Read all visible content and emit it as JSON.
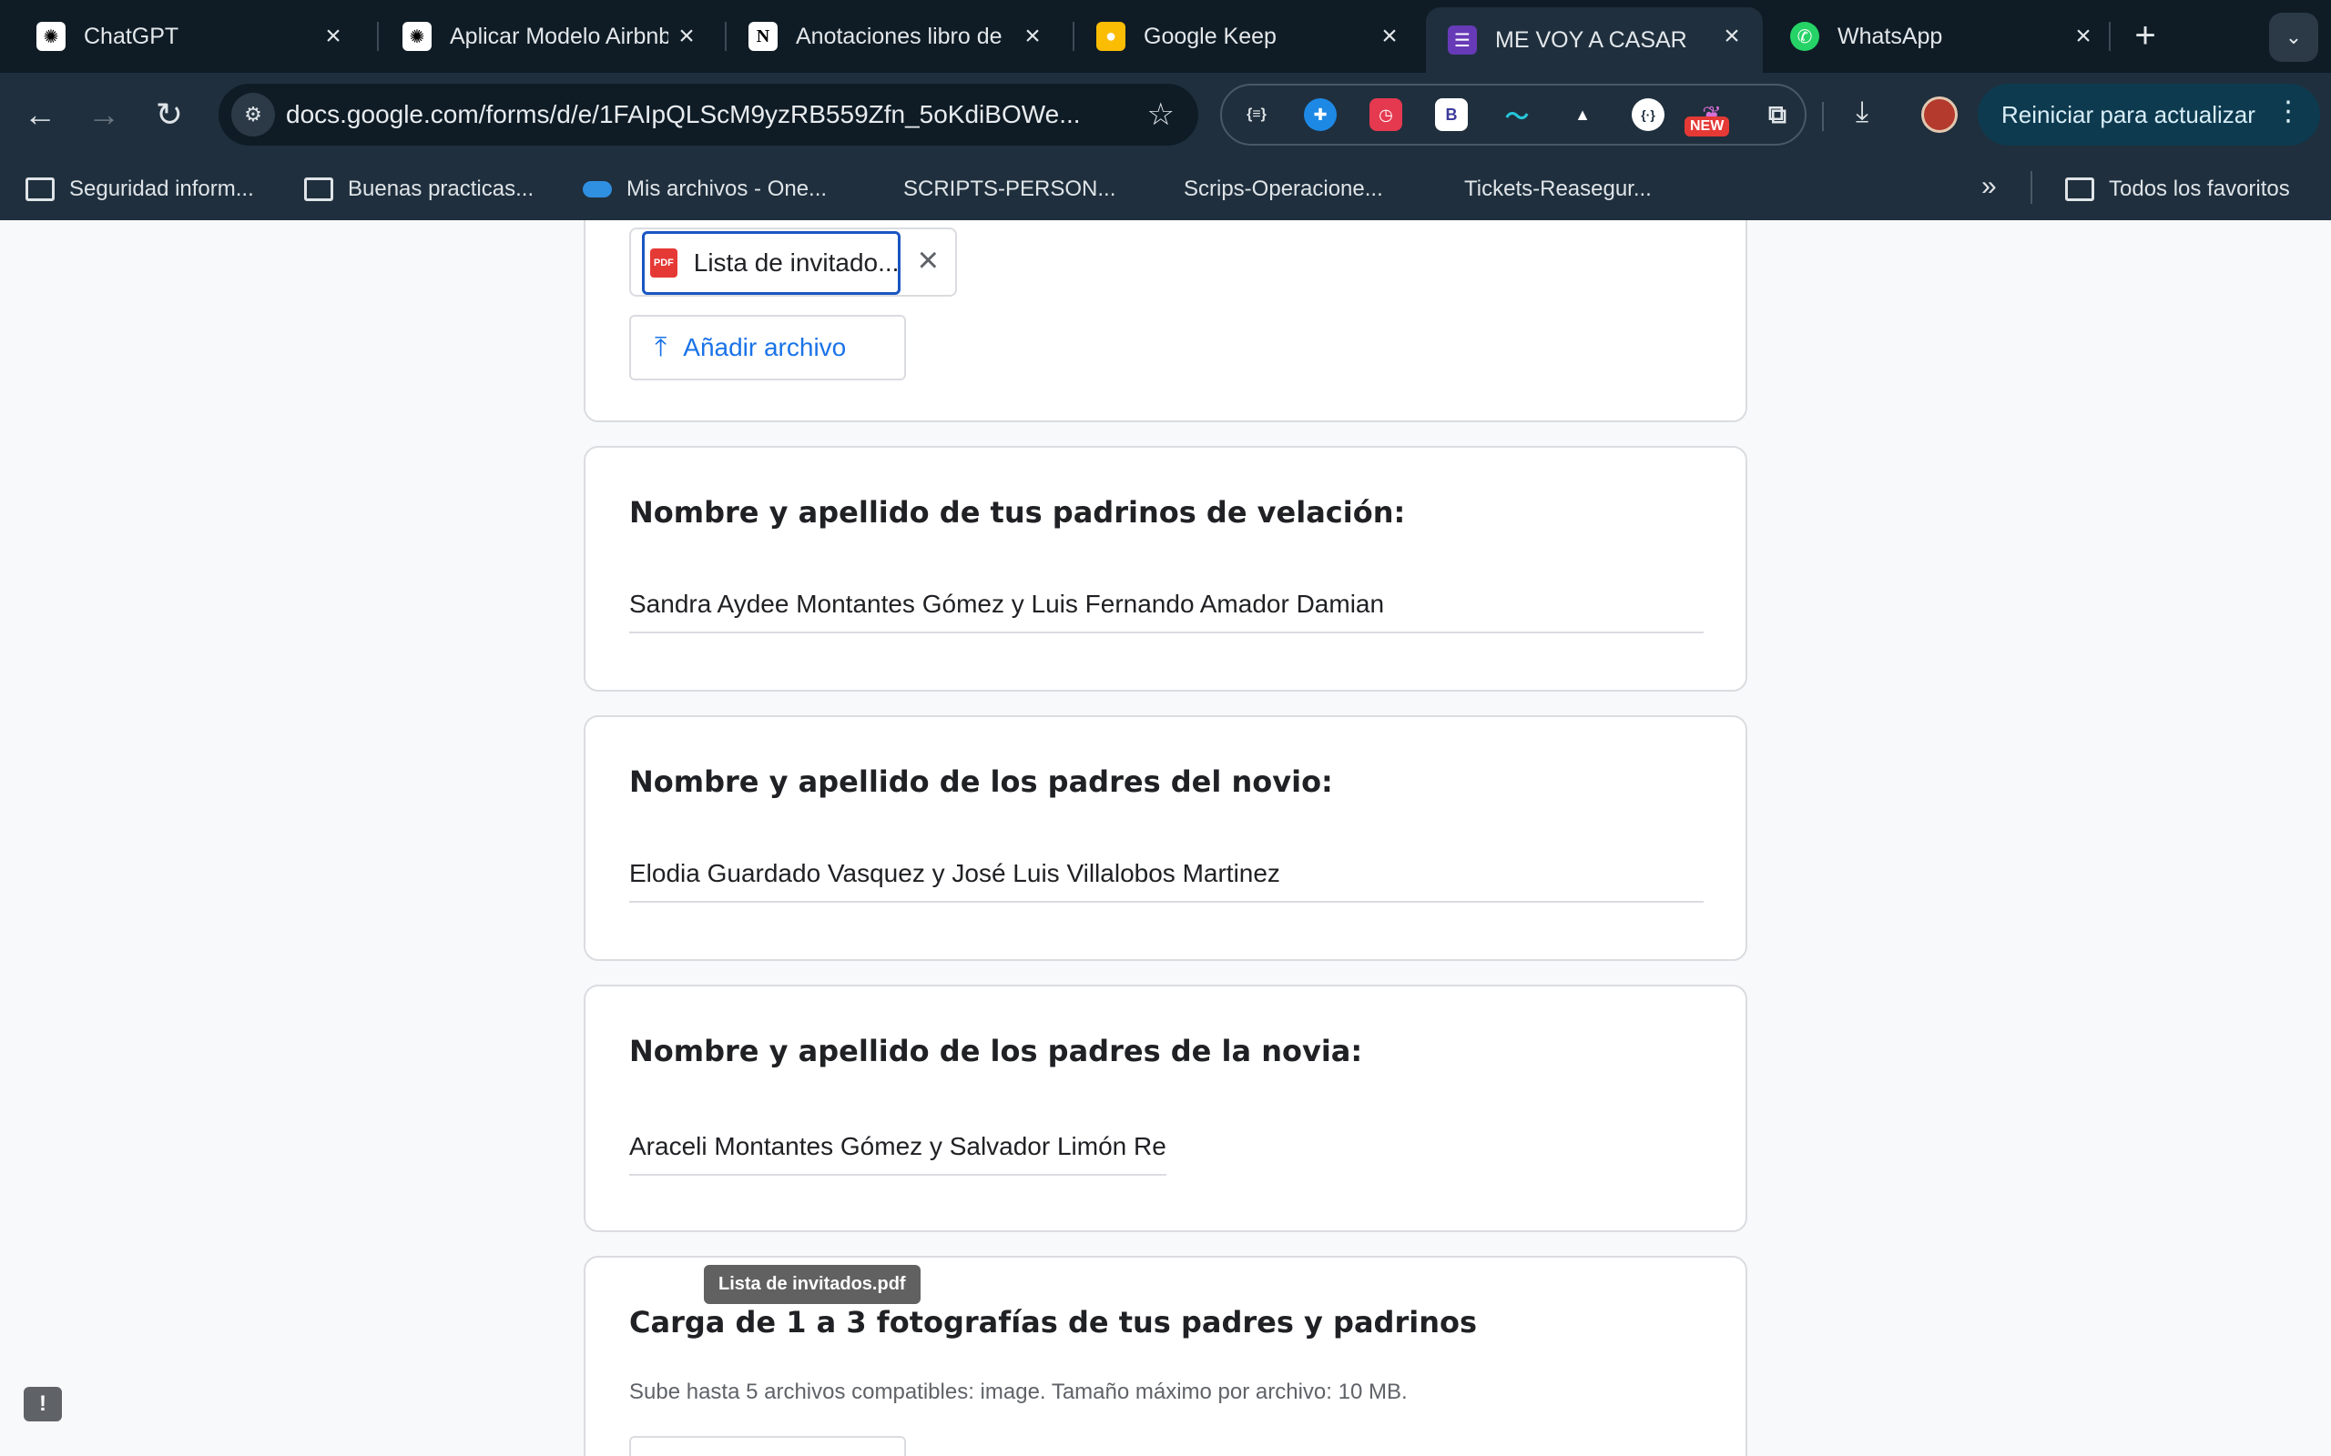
{
  "browser": {
    "tabs": [
      {
        "title": "ChatGPT",
        "icon": "openai-icon"
      },
      {
        "title": "Aplicar Modelo Airbnb",
        "icon": "openai-icon"
      },
      {
        "title": "Anotaciones libro de",
        "icon": "notion-icon"
      },
      {
        "title": "Google Keep",
        "icon": "keep-icon"
      },
      {
        "title": "ME VOY A CASAR",
        "icon": "forms-icon"
      },
      {
        "title": "WhatsApp",
        "icon": "whatsapp-icon"
      }
    ],
    "url": "docs.google.com/forms/d/e/1FAIpQLScM9yzRB559Zfn_5oKdiBOWe...",
    "update_button": "Reiniciar para actualizar",
    "extension_badge": "NEW",
    "bookmarks": [
      {
        "label": "Seguridad inform...",
        "icon": "folder-icon"
      },
      {
        "label": "Buenas practicas...",
        "icon": "folder-icon"
      },
      {
        "label": "Mis archivos - One...",
        "icon": "onedrive-icon"
      },
      {
        "label": "SCRIPTS-PERSON...",
        "icon": "microsoft-icon"
      },
      {
        "label": "Scrips-Operacione...",
        "icon": "microsoft-icon"
      },
      {
        "label": "Tickets-Reasegur...",
        "icon": "microsoft-icon"
      }
    ],
    "all_bookmarks": "Todos los favoritos"
  },
  "form": {
    "upload_section": {
      "file_name": "Lista de invitados.pdf",
      "file_chip_label": "Lista de invitado...",
      "add_file_label": "Añadir archivo"
    },
    "questions": [
      {
        "title": "Nombre y apellido de tus padrinos de velación:",
        "answer": "Sandra Aydee Montantes Gómez y Luis Fernando Amador Damian"
      },
      {
        "title": "Nombre y apellido de los padres del novio:",
        "answer": "Elodia Guardado Vasquez y José Luis Villalobos Martinez"
      },
      {
        "title": "Nombre y apellido de los padres de la novia:",
        "answer": "Araceli Montantes Gómez y Salvador Limón Re"
      }
    ],
    "photo_upload": {
      "title": "Carga de 1 a 3 fotografías de tus padres y padrinos",
      "helper": "Sube hasta 5 archivos compatibles: image. Tamaño máximo por archivo: 10 MB."
    },
    "tooltip": "Lista de invitados.pdf"
  },
  "colors": {
    "accent": "#1a73e8",
    "chrome_bg": "#1f2f3d",
    "tabstrip_bg": "#0f1c26",
    "card_border": "#dadce0"
  }
}
